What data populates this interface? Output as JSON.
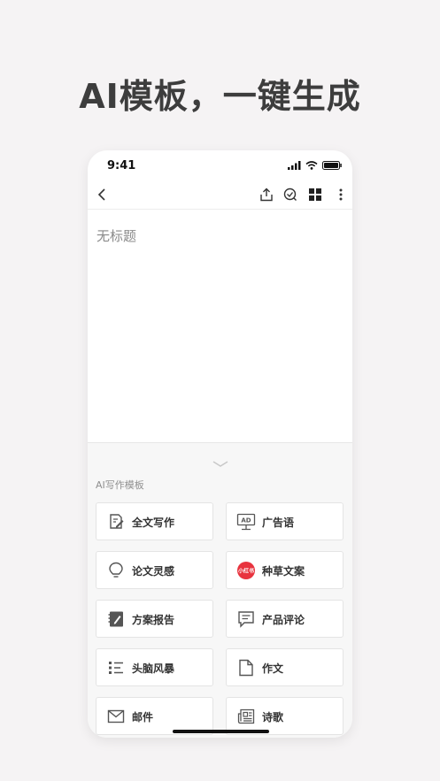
{
  "headline": "AI模板，一键生成",
  "status": {
    "time": "9:41"
  },
  "document": {
    "title_placeholder": "无标题"
  },
  "panel": {
    "section_label": "AI写作模板",
    "templates": [
      {
        "label": "全文写作",
        "icon": "edit-document-icon"
      },
      {
        "label": "广告语",
        "icon": "ad-monitor-icon"
      },
      {
        "label": "论文灵感",
        "icon": "lightbulb-icon"
      },
      {
        "label": "种草文案",
        "icon": "xiaohongshu-logo",
        "icon_text": "小红书",
        "icon_color": "#e8333e"
      },
      {
        "label": "方案报告",
        "icon": "notebook-icon"
      },
      {
        "label": "产品评论",
        "icon": "comment-icon"
      },
      {
        "label": "头脑风暴",
        "icon": "list-icon"
      },
      {
        "label": "作文",
        "icon": "file-icon"
      },
      {
        "label": "邮件",
        "icon": "mail-icon"
      },
      {
        "label": "诗歌",
        "icon": "newspaper-icon"
      }
    ]
  }
}
